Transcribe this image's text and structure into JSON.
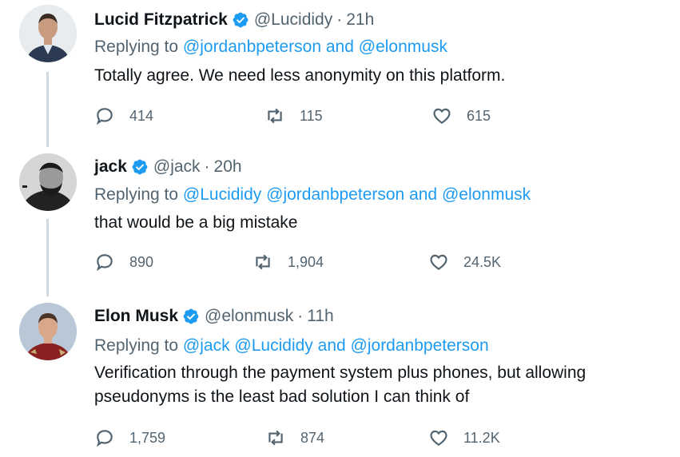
{
  "tweets": [
    {
      "name": "Lucid Fitzpatrick",
      "handle": "@Lucididy",
      "sep": "·",
      "time": "21h",
      "replying_prefix": "Replying to",
      "mentions": [
        "@jordanbpeterson",
        "@elonmusk"
      ],
      "joiner": "and",
      "body": "Totally agree. We need less anonymity on this platform.",
      "reply_count": "414",
      "retweet_count": "115",
      "like_count": "615",
      "avatar_colors": {
        "bg": "#e8ecef",
        "skin": "#c89a7e",
        "hair": "#3a2a22",
        "suit": "#2b3a52",
        "shirt": "#dfe6ee"
      }
    },
    {
      "name": "jack",
      "handle": "@jack",
      "sep": "·",
      "time": "20h",
      "replying_prefix": "Replying to",
      "mentions": [
        "@Lucididy",
        "@jordanbpeterson",
        "@elonmusk"
      ],
      "joiner": "and",
      "body": "that would be a big mistake",
      "reply_count": "890",
      "retweet_count": "1,904",
      "like_count": "24.5K",
      "avatar_colors": {
        "bg": "#d6d6d6",
        "skin": "#9a9a9a",
        "hair": "#1a1a1a"
      }
    },
    {
      "name": "Elon Musk",
      "handle": "@elonmusk",
      "sep": "·",
      "time": "11h",
      "replying_prefix": "Replying to",
      "mentions": [
        "@jack",
        "@Lucididy",
        "@jordanbpeterson"
      ],
      "joiner": "and",
      "body": "Verification through the payment system plus phones, but allowing pseudonyms is the least bad solution I can think of",
      "reply_count": "1,759",
      "retweet_count": "874",
      "like_count": "11.2K",
      "avatar_colors": {
        "bg": "#b9c7d6",
        "skin": "#d9a88a",
        "hair": "#4a3428",
        "suit": "#8a2020"
      }
    }
  ],
  "colors": {
    "link": "#1d9bf0",
    "muted": "#536471",
    "verified": "#1d9bf0",
    "thread_line": "#cfd9de"
  },
  "icons": {
    "verified": "verified-badge-icon",
    "reply": "reply-icon",
    "retweet": "retweet-icon",
    "like": "heart-icon"
  }
}
